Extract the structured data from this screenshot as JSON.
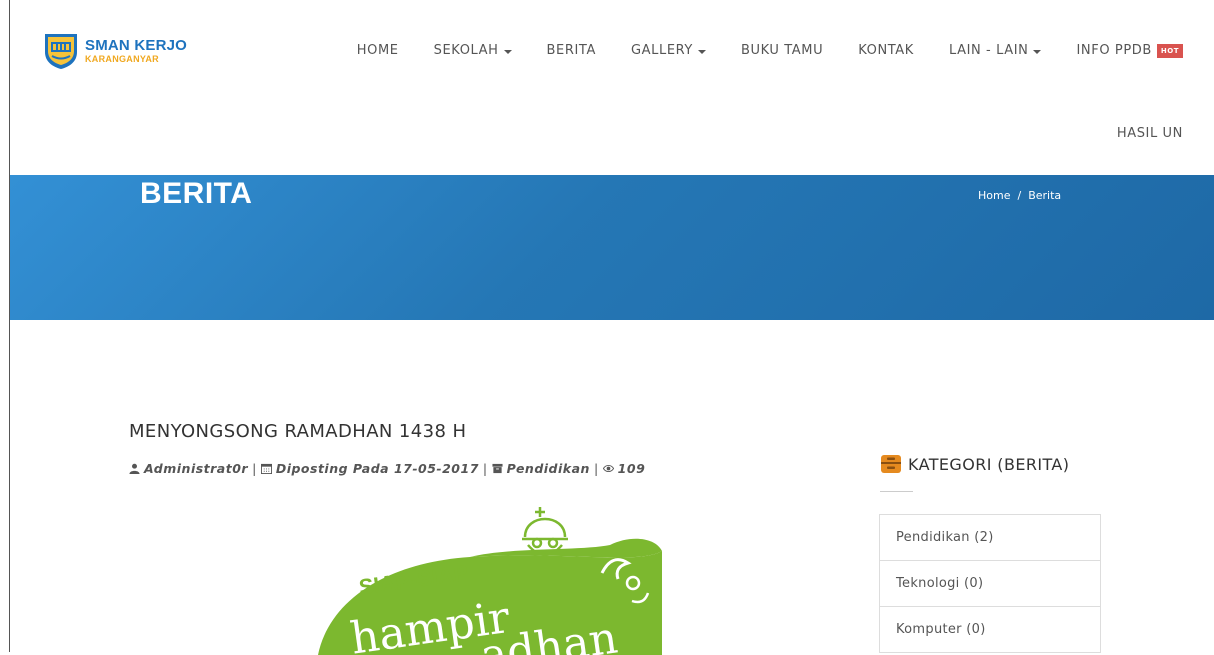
{
  "logo": {
    "title": "SMAN KERJO",
    "subtitle": "KARANGANYAR"
  },
  "nav": {
    "items": [
      {
        "label": "HOME",
        "caret": false
      },
      {
        "label": "SEKOLAH",
        "caret": true
      },
      {
        "label": "BERITA",
        "caret": false
      },
      {
        "label": "GALLERY",
        "caret": true
      },
      {
        "label": "BUKU TAMU",
        "caret": false
      },
      {
        "label": "KONTAK",
        "caret": false
      },
      {
        "label": "LAIN - LAIN",
        "caret": true
      },
      {
        "label": "INFO PPDB",
        "caret": false
      }
    ],
    "hot_badge": "HOT",
    "row2_item": "HASIL UN"
  },
  "banner": {
    "title": "BERITA",
    "breadcrumb": [
      "Home",
      "Berita"
    ],
    "separator": "/"
  },
  "article": {
    "title": "MENYONGSONG RAMADHAN 1438 H",
    "author": "Administrat0r",
    "posted": "Diposting Pada 17-05-2017",
    "category": "Pendidikan",
    "views": "109",
    "image_text": {
      "top": "SIAP-SIAP",
      "line1": "hampir",
      "line2": "adhan"
    }
  },
  "sidebar": {
    "title": "KATEGORI (BERITA)",
    "categories": [
      "Pendidikan (2)",
      "Teknologi (0)",
      "Komputer (0)"
    ]
  },
  "colors": {
    "brand_blue": "#1e73be",
    "banner_blue": "#2577b5",
    "hot_red": "#d9534f",
    "image_green": "#7cb82f"
  }
}
